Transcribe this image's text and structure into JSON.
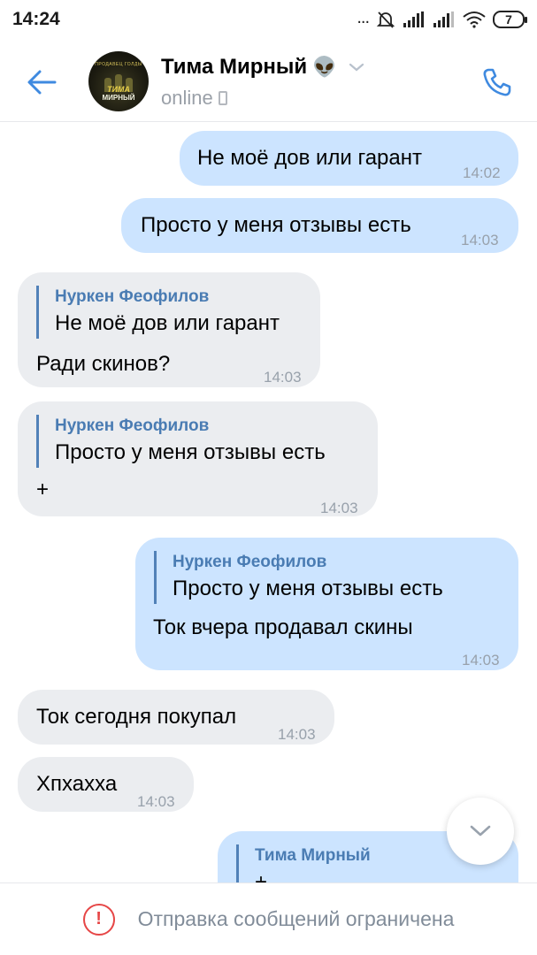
{
  "status_bar": {
    "time": "14:24",
    "signal_dots": "...",
    "battery": "7",
    "icons": [
      "mute-icon",
      "signal-icon",
      "signal-icon",
      "wifi-icon",
      "battery-icon"
    ]
  },
  "header": {
    "back_icon": "back-arrow-icon",
    "avatar": {
      "caption_top": "ПРОДАВЕЦ ГОЛДЫ",
      "caption_line1": "ТИМА",
      "caption_line2": "МИРНЫЙ"
    },
    "contact_name": "Тима Мирный",
    "contact_emoji": "👽",
    "status": "online",
    "call_icon": "phone-icon"
  },
  "messages": [
    {
      "dir": "out",
      "text": "Не моё дов или гарант",
      "time": "14:02"
    },
    {
      "dir": "out",
      "text": "Просто у меня отзывы есть",
      "time": "14:03"
    },
    {
      "dir": "in",
      "quote_author": "Нуркен Феофилов",
      "quote_text": "Не моё дов или гарант",
      "text": "Ради скинов?",
      "time": "14:03"
    },
    {
      "dir": "in",
      "quote_author": "Нуркен Феофилов",
      "quote_text": "Просто у меня отзывы есть",
      "text": "+",
      "time": "14:03"
    },
    {
      "dir": "out",
      "quote_author": "Нуркен Феофилов",
      "quote_text": "Просто у меня отзывы есть",
      "text": "Ток вчера продавал скины",
      "time": "14:03"
    },
    {
      "dir": "in",
      "text": "Ток сегодня покупал",
      "time": "14:03"
    },
    {
      "dir": "in",
      "text": "Хпхахха",
      "time": "14:03"
    },
    {
      "dir": "out",
      "quote_author": "Тима Мирный",
      "quote_text": "+"
    }
  ],
  "bottom_bar": {
    "icon": "warning-icon",
    "icon_glyph": "!",
    "text": "Отправка сообщений ограничена"
  },
  "colors": {
    "outgoing_bubble": "#cce4ff",
    "incoming_bubble": "#ebedf0",
    "accent": "#4a7cb3",
    "warning": "#e64646"
  }
}
